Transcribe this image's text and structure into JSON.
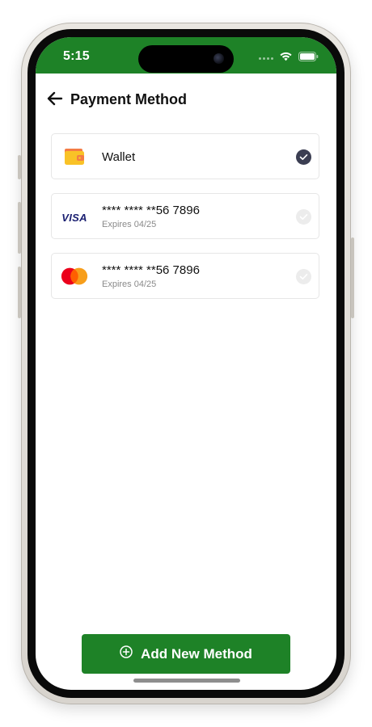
{
  "status_bar": {
    "time": "5:15",
    "background": "#1e8227"
  },
  "header": {
    "title": "Payment Method",
    "back_icon": "arrow-left-icon"
  },
  "payment_methods": [
    {
      "type": "wallet",
      "icon": "wallet-icon",
      "title": "Wallet",
      "subtitle": "",
      "selected": true
    },
    {
      "type": "visa",
      "icon": "visa-logo",
      "logo_text": "VISA",
      "title": "**** **** **56 7896",
      "subtitle": "Expires 04/25",
      "selected": false
    },
    {
      "type": "mastercard",
      "icon": "mastercard-logo",
      "title": "**** **** **56 7896",
      "subtitle": "Expires 04/25",
      "selected": false
    }
  ],
  "actions": {
    "add_label": "Add New Method",
    "add_icon": "plus-circle-icon"
  },
  "colors": {
    "accent": "#1e8227",
    "selected_check": "#3b3e52",
    "unselected_check": "#ececec"
  }
}
